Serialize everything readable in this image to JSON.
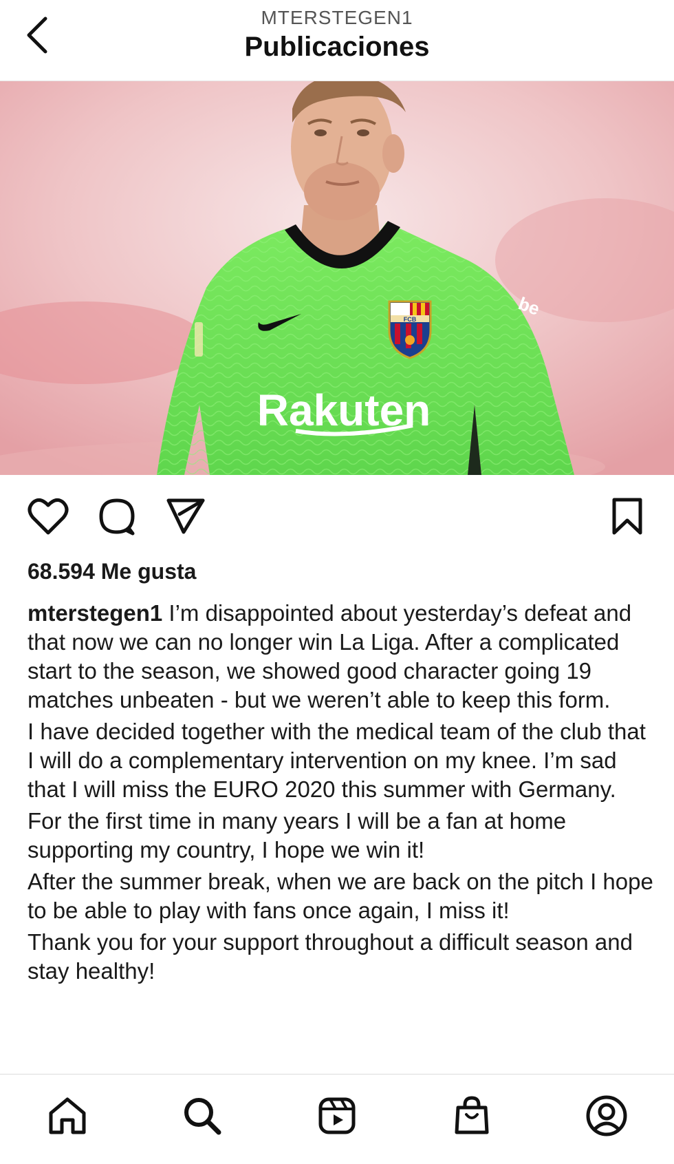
{
  "header": {
    "username": "MTERSTEGEN1",
    "title": "Publicaciones"
  },
  "icons": {
    "back": "chevron-left-icon",
    "like": "heart-icon",
    "comment": "comment-icon",
    "share": "send-icon",
    "save": "bookmark-icon",
    "home": "home-icon",
    "search": "search-icon",
    "reels": "reels-icon",
    "shop": "shopping-bag-icon",
    "profile": "profile-icon"
  },
  "image": {
    "jersey_text": "Rakuten",
    "badge_text": "FCB",
    "sponsor_sleeve": "be",
    "colors": {
      "background": "#e9b5b8",
      "jersey": "#6fe35a",
      "skin": "#e3b194",
      "hair": "#9a6e4c"
    }
  },
  "post": {
    "likes": "68.594 Me gusta",
    "caption_user": "mterstegen1",
    "caption_paragraphs": [
      "I’m disappointed about yesterday’s defeat and that now we can no longer win La Liga. After a complicated start to the season, we showed good character going 19 matches unbeaten - but we weren’t able to keep this form.",
      "I have decided together with the medical team of the club that I will do a complementary intervention on my knee. I’m sad that I will miss the EURO 2020 this summer with Germany.",
      "For the first time in many years I will be a fan at home supporting my country, I hope we win it!",
      "After the summer break, when we are back on the pitch I hope to be able to play with fans once again, I miss it!",
      "Thank you for your support throughout a difficult season and stay healthy!"
    ]
  }
}
